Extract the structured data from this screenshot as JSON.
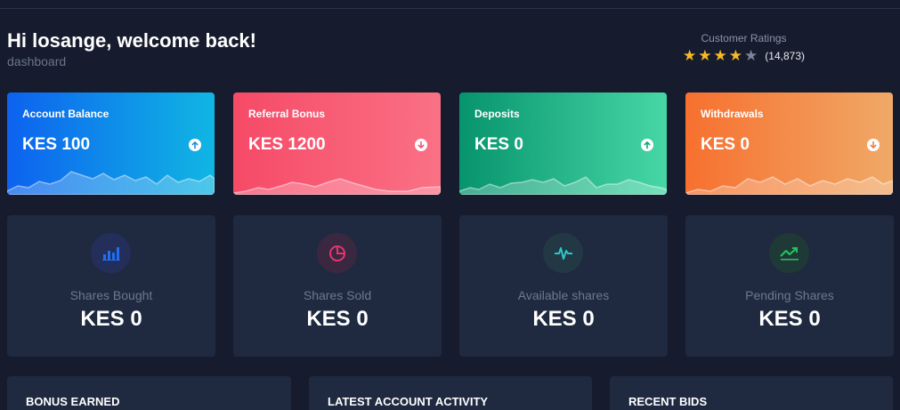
{
  "header": {
    "greeting": "Hi losange, welcome back!",
    "subtitle": "dashboard"
  },
  "ratings": {
    "label": "Customer Ratings",
    "stars_filled": 4,
    "stars_total": 5,
    "count": "(14,873)"
  },
  "stat_cards": [
    {
      "label": "Account Balance",
      "value": "KES 100",
      "arrow": "up-arrow-icon",
      "color_start": "#0d62ef",
      "color_end": "#10b6e3"
    },
    {
      "label": "Referral Bonus",
      "value": "KES 1200",
      "arrow": "down-arrow-icon",
      "color_start": "#f64a67",
      "color_end": "#fa7185"
    },
    {
      "label": "Deposits",
      "value": "KES 0",
      "arrow": "up-arrow-icon",
      "color_start": "#07946d",
      "color_end": "#47d7a6"
    },
    {
      "label": "Withdrawals",
      "value": "KES 0",
      "arrow": "down-arrow-icon",
      "color_start": "#f7702f",
      "color_end": "#f0a967"
    }
  ],
  "share_cards": [
    {
      "label": "Shares Bought",
      "value": "KES 0",
      "icon": "bar-chart-icon",
      "icon_color": "#1f6ff0"
    },
    {
      "label": "Shares Sold",
      "value": "KES 0",
      "icon": "pie-chart-icon",
      "icon_color": "#e5356f"
    },
    {
      "label": "Available shares",
      "value": "KES 0",
      "icon": "activity-pulse-icon",
      "icon_color": "#2bc7c7"
    },
    {
      "label": "Pending Shares",
      "value": "KES 0",
      "icon": "trending-up-icon",
      "icon_color": "#22c55e"
    }
  ],
  "panels": [
    {
      "title": "BONUS EARNED"
    },
    {
      "title": "LATEST ACCOUNT ACTIVITY"
    },
    {
      "title": "RECENT BIDS"
    }
  ]
}
